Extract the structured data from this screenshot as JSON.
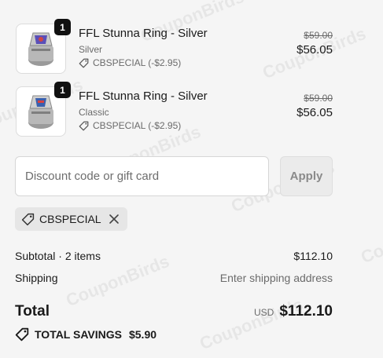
{
  "items": [
    {
      "quantity": "1",
      "name": "FFL Stunna Ring - Silver",
      "variant": "Silver",
      "discount": "CBSPECIAL (-$2.95)",
      "original_price": "$59.00",
      "final_price": "$56.05"
    },
    {
      "quantity": "1",
      "name": "FFL Stunna Ring - Silver",
      "variant": "Classic",
      "discount": "CBSPECIAL (-$2.95)",
      "original_price": "$59.00",
      "final_price": "$56.05"
    }
  ],
  "discount_field": {
    "placeholder": "Discount code or gift card",
    "value": "",
    "apply_label": "Apply"
  },
  "applied_code": "CBSPECIAL",
  "summary": {
    "subtotal_label": "Subtotal · 2 items",
    "subtotal_value": "$112.10",
    "shipping_label": "Shipping",
    "shipping_value": "Enter shipping address",
    "total_label": "Total",
    "currency": "USD",
    "total_value": "$112.10",
    "savings_label": "TOTAL SAVINGS",
    "savings_value": "$5.90"
  },
  "watermark": "CouponBirds",
  "icons": {
    "tag": "tag-icon",
    "remove": "close-icon",
    "savings": "tag-icon"
  },
  "colors": {
    "background": "#f5f5f5",
    "text": "#1a1a1a",
    "muted": "#6b6b6b",
    "badge": "#111111"
  }
}
